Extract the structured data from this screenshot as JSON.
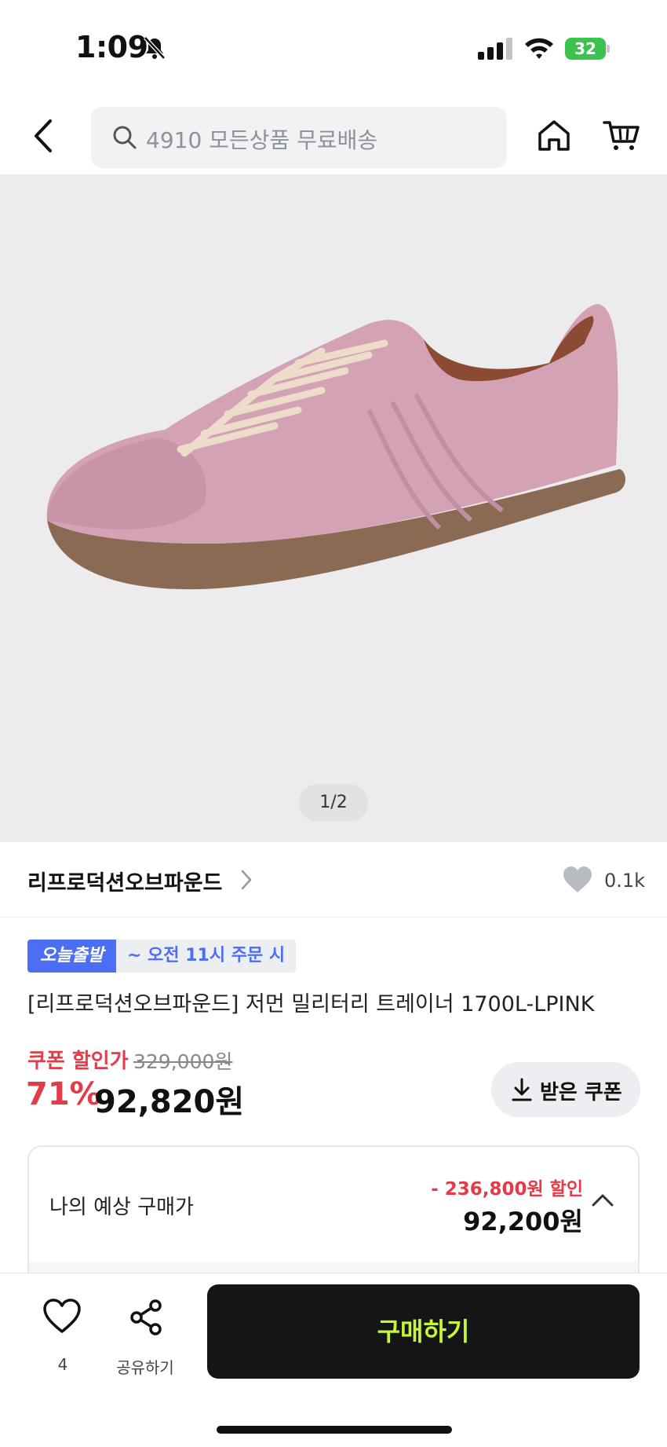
{
  "status_bar": {
    "time": "1:09",
    "battery": "32"
  },
  "header": {
    "search_placeholder": "4910 모든상품 무료배송"
  },
  "gallery": {
    "indicator": "1/2"
  },
  "brand": {
    "name": "리프로덕션오브파운드",
    "like_count": "0.1k"
  },
  "badges": {
    "today": "오늘출발",
    "time": "~ 오전 11시 주문 시"
  },
  "product": {
    "title": "[리프로덕션오브파운드] 저먼 밀리터리 트레이너 1700L-LPINK",
    "coupon_label": "쿠폰 할인가",
    "original_price": "329,000원",
    "discount_rate": "71%",
    "sale_price": "92,820원",
    "coupon_button": "받은 쿠폰"
  },
  "estimate": {
    "label": "나의 예상 구매가",
    "discount": "- 236,800원 할인",
    "price": "92,200원"
  },
  "bottom_bar": {
    "wish_count": "4",
    "share_label": "공유하기",
    "buy_label": "구매하기"
  },
  "colors": {
    "accent_red": "#e33b47",
    "badge_blue": "#4c6ef5",
    "buy_text": "#c6f53a"
  }
}
